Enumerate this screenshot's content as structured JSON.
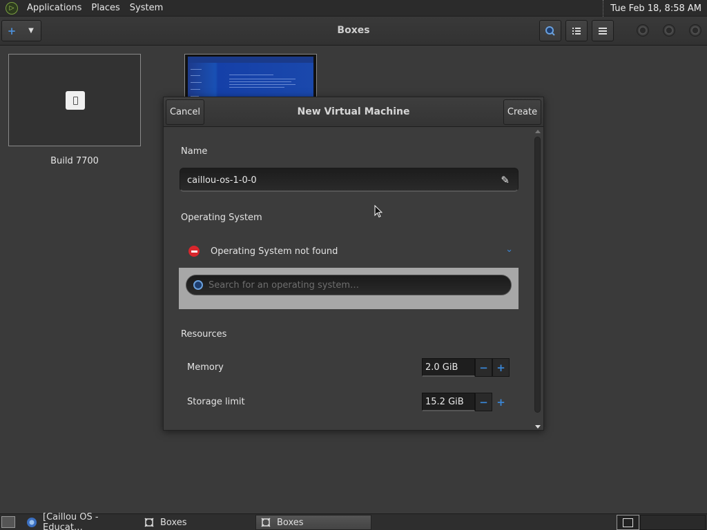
{
  "top_panel": {
    "menus": [
      "Applications",
      "Places",
      "System"
    ],
    "clock": "Tue Feb 18,  8:58 AM"
  },
  "headerbar": {
    "title": "Boxes",
    "new_icon": "plus-icon",
    "accent": "#4c8fd8"
  },
  "collection": {
    "items": [
      {
        "label": "Build 7700",
        "icon": "device-icon"
      },
      {
        "label": "",
        "thumbnail": "windows-setup-screen"
      }
    ]
  },
  "dialog": {
    "cancel_label": "Cancel",
    "title": "New Virtual Machine",
    "create_label": "Create",
    "name_label": "Name",
    "name_value": "caillou-os-1-0-0",
    "os_label": "Operating System",
    "os_status": "Operating System not found",
    "os_search_placeholder": "Search for an operating system…",
    "resources_label": "Resources",
    "resources": [
      {
        "label": "Memory",
        "value": "2.0 GiB"
      },
      {
        "label": "Storage limit",
        "value": "15.2 GiB"
      }
    ],
    "error_color": "#d8262c"
  },
  "taskbar": {
    "tasks": [
      {
        "label": "[Caillou OS - Educat…",
        "icon": "browser-icon"
      },
      {
        "label": "Boxes",
        "icon": "boxes-icon"
      },
      {
        "label": "Boxes",
        "icon": "boxes-icon",
        "active": true
      }
    ]
  }
}
